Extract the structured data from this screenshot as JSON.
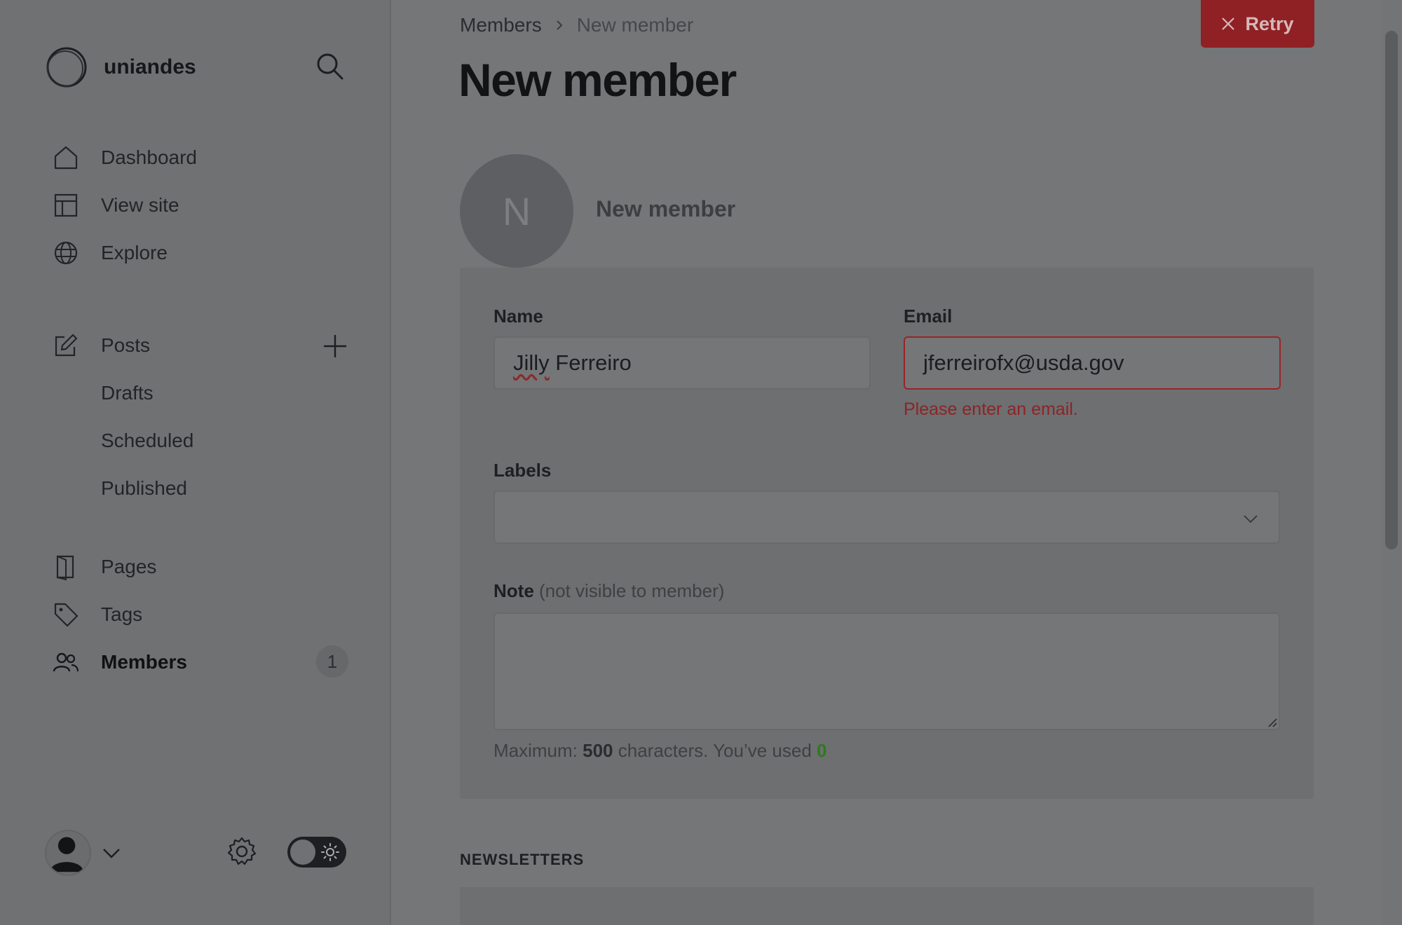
{
  "sidebar": {
    "brand": "uniandes",
    "nav": {
      "dashboard": "Dashboard",
      "view_site": "View site",
      "explore": "Explore",
      "posts": "Posts",
      "drafts": "Drafts",
      "scheduled": "Scheduled",
      "published": "Published",
      "pages": "Pages",
      "tags": "Tags",
      "members": "Members",
      "members_count": "1"
    }
  },
  "header": {
    "breadcrumb_parent": "Members",
    "breadcrumb_current": "New member",
    "retry_label": "Retry",
    "title": "New member"
  },
  "member": {
    "avatar_initial": "N",
    "display_name": "New member"
  },
  "form": {
    "name_label": "Name",
    "name_first": "Jilly",
    "name_rest": " Ferreiro",
    "email_label": "Email",
    "email_value": "jferreirofx@usda.gov",
    "email_error": "Please enter an email.",
    "labels_label": "Labels",
    "note_label": "Note",
    "note_muted": " (not visible to member)",
    "hint_prefix": "Maximum: ",
    "hint_max": "500",
    "hint_mid": " characters. You’ve used ",
    "hint_used": "0"
  },
  "sections": {
    "newsletters": "NEWSLETTERS"
  },
  "icons": {
    "logo": "logo-circle-icon",
    "search": "search-icon",
    "home": "home-icon",
    "layout": "layout-icon",
    "globe": "globe-icon",
    "edit": "edit-icon",
    "plus": "plus-icon",
    "page": "page-icon",
    "tag": "tag-icon",
    "users": "users-icon",
    "gear": "gear-icon",
    "sun": "sun-icon",
    "close": "close-icon",
    "chevron": "chevron-down-icon"
  },
  "colors": {
    "danger": "#8f2124",
    "success": "#2f7a1d",
    "overlay_bg": "#747678"
  }
}
